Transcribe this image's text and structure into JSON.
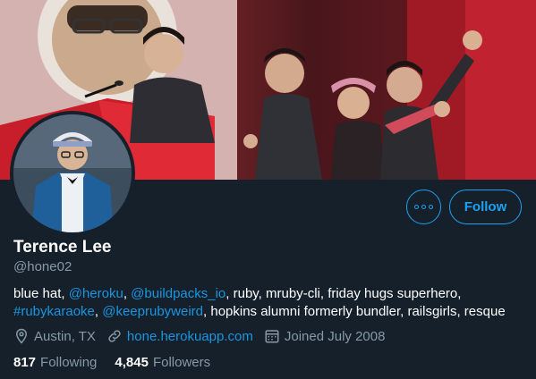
{
  "profile": {
    "name": "Terence Lee",
    "handle": "@hone02",
    "bio": {
      "t1": "blue hat, ",
      "m1": "@heroku",
      "t2": ", ",
      "m2": "@buildpacks_io",
      "t3": ", ruby, mruby-cli, friday hugs superhero,",
      "m3": "#rubykaraoke",
      "t4": ", ",
      "m4": "@keeprubyweird",
      "t5": ", hopkins alumni formerly bundler, railsgirls, resque"
    },
    "location": "Austin, TX",
    "website": "hone.herokuapp.com",
    "joined": "Joined July 2008"
  },
  "stats": {
    "following_count": "817",
    "following_label": "Following",
    "followers_count": "4,845",
    "followers_label": "Followers"
  },
  "actions": {
    "follow_label": "Follow"
  },
  "icons": {
    "more": "more-horizontal-icon",
    "location": "location-pin-icon",
    "link": "link-icon",
    "calendar": "calendar-icon"
  },
  "colors": {
    "background": "#15202b",
    "accent": "#1da1f2",
    "link": "#1b95e0",
    "secondary_text": "#8899a6"
  }
}
